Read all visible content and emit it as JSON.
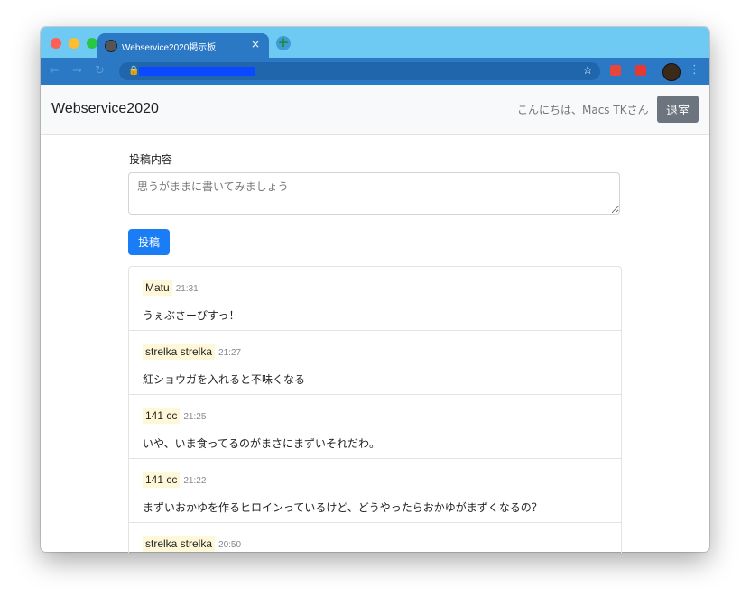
{
  "browser": {
    "tab_title": "Webservice2020掲示板",
    "tab_close": "×",
    "new_tab": "+"
  },
  "navbar": {
    "brand": "Webservice2020",
    "greeting": "こんにちは、Macs TKさん",
    "logout_label": "退室"
  },
  "form": {
    "label": "投稿内容",
    "placeholder": "思うがままに書いてみましょう",
    "value": "",
    "submit_label": "投稿"
  },
  "posts": [
    {
      "author": "Matu",
      "time": "21:31",
      "body": "うぇぶさーびすっ！"
    },
    {
      "author": "strelka strelka",
      "time": "21:27",
      "body": "紅ショウガを入れると不味くなる"
    },
    {
      "author": "141 cc",
      "time": "21:25",
      "body": "いや、いま食ってるのがまさにまずいそれだわ。"
    },
    {
      "author": "141 cc",
      "time": "21:22",
      "body": "まずいおかゆを作るヒロインっているけど、どうやったらおかゆがまずくなるの？"
    },
    {
      "author": "strelka strelka",
      "time": "20:50",
      "body": ""
    }
  ],
  "colors": {
    "tab_strip": "#6ecaf2",
    "toolbar": "#2b78c5",
    "primary": "#1a7df5",
    "secondary": "#6c757d"
  }
}
